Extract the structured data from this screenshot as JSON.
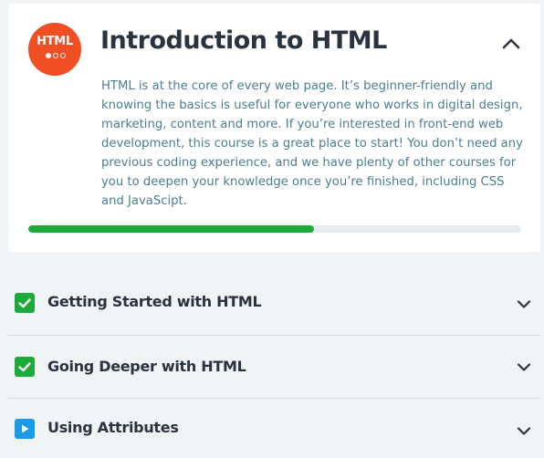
{
  "course": {
    "logo_text": "HTML",
    "title": "Introduction to HTML",
    "description": "HTML is at the core of every web page. It’s beginner-friendly and knowing the basics is useful for everyone who works in digital design, marketing, content and more. If you’re interested in front-end web development, this course is a great place to start! You don’t need any previous coding experience, and we have plenty of other courses for you to deepen your knowledge once you’re finished, including CSS and JavaScipt.",
    "progress_fraction": 0.58,
    "expanded": true,
    "collapse_icon": "chevron-up-icon"
  },
  "modules": [
    {
      "label": "Getting Started with HTML",
      "status": "completed",
      "status_icon": "checkmark-icon",
      "expand_icon": "chevron-down-icon"
    },
    {
      "label": "Going Deeper with HTML",
      "status": "completed",
      "status_icon": "checkmark-icon",
      "expand_icon": "chevron-down-icon"
    },
    {
      "label": "Using Attributes",
      "status": "in-progress",
      "status_icon": "play-icon",
      "expand_icon": "chevron-down-icon"
    }
  ],
  "colors": {
    "logo_bg": "#f04e23",
    "progress": "#1eaa3a",
    "completed": "#1eaa3a",
    "in_progress": "#1a9ae8",
    "description_text": "#4b7e92",
    "title_text": "#2a3340"
  }
}
